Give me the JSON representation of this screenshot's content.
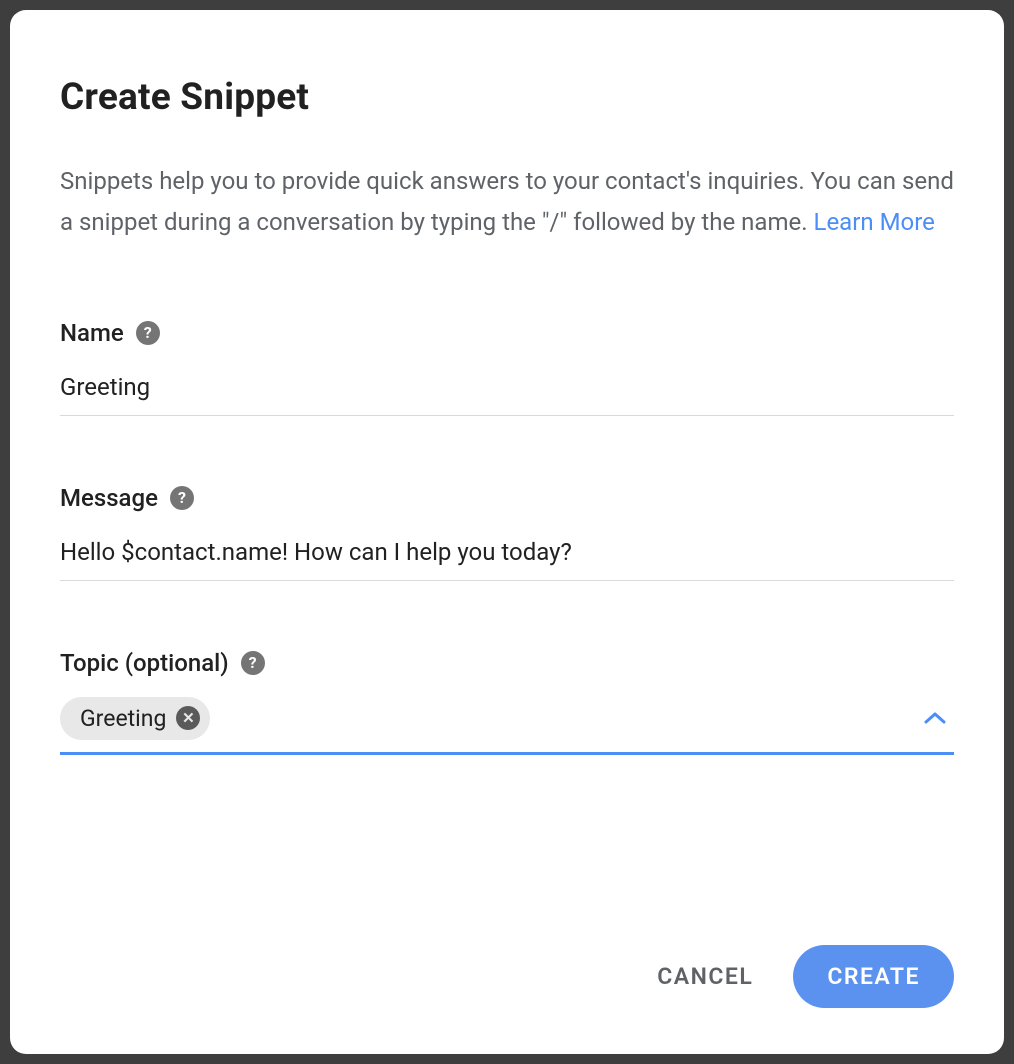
{
  "modal": {
    "title": "Create Snippet",
    "description": "Snippets help you to provide quick answers to your contact's inquiries. You can send a snippet during a conversation by typing the \"/\" followed by the name. ",
    "learn_more": "Learn More"
  },
  "fields": {
    "name": {
      "label": "Name",
      "value": "Greeting"
    },
    "message": {
      "label": "Message",
      "value": "Hello $contact.name! How can I help you today?"
    },
    "topic": {
      "label": "Topic (optional)",
      "chips": [
        {
          "label": "Greeting"
        }
      ]
    }
  },
  "actions": {
    "cancel": "CANCEL",
    "create": "CREATE"
  },
  "icons": {
    "help": "?",
    "remove": "✕"
  },
  "colors": {
    "accent": "#4c8df6",
    "button": "#5b92f0",
    "text_muted": "#5f6368"
  }
}
